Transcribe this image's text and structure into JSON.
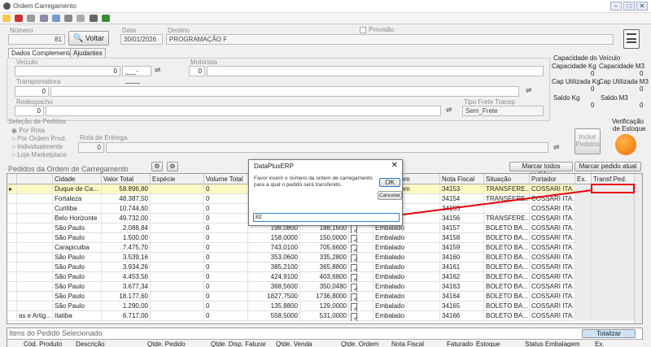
{
  "window": {
    "title": "Ordem Carregamento"
  },
  "header": {
    "numero_label": "Número",
    "numero_value": "81",
    "voltar_label": "Voltar",
    "data_label": "Data",
    "data_value": "30/01/2026",
    "destino_label": "Destino",
    "destino_value": "PROGRAMAÇÃO F",
    "previsao_label": "Previsão"
  },
  "tabs": [
    "Dados Complementares",
    "Ajudantes"
  ],
  "form": {
    "veiculo_label": "Veículo",
    "veiculo_value": "0",
    "placa_value": "___-____",
    "motorista_label": "Motorista",
    "motorista_value": "0",
    "transportadora_label": "Transportadora",
    "transportadora_value": "0",
    "redespacho_label": "Redespacho",
    "redespacho_value": "0",
    "tipo_frete_label": "Tipo Frete Transp",
    "tipo_frete_value": "Sem_Frete"
  },
  "capacidade": {
    "title": "Capacidade do Veículo",
    "cap_kg_label": "Capacidade Kg",
    "cap_kg_value": "0",
    "cap_m3_label": "Capacidade M3",
    "cap_m3_value": "0",
    "util_kg_label": "Cap Utilizada Kg",
    "util_kg_value": "0",
    "util_m3_label": "Cap Utilizada M3",
    "util_m3_value": "0",
    "saldo_kg_label": "Saldo Kg",
    "saldo_kg_value": "0",
    "saldo_m3_label": "Saldo M3",
    "saldo_m3_value": "0"
  },
  "selecao": {
    "title": "Seleção de Pedidos",
    "options": [
      "Por Rota",
      "Por Ordem Prod.",
      "Individualmente",
      "Loja Marketplace"
    ],
    "rota_label": "Rota de Entrega",
    "rota_value": "0",
    "incluir_label_1": "Incluir",
    "incluir_label_2": "Pedidos"
  },
  "estoque": {
    "label_1": "Verificação",
    "label_2": "de Estoque"
  },
  "pedidos": {
    "title": "Pedidos da Ordem de Carregamento",
    "marcar_todos": "Marcar todos pedidos",
    "marcar_atual": "Marcar pedido atual",
    "columns": [
      "Cidade",
      "Valor Total",
      "Espécie",
      "Volume Total",
      "",
      "",
      "",
      "Embalagem",
      "Nota Fiscal",
      "Situação",
      "Portador",
      "Ex.",
      "Transf.Ped."
    ],
    "rows": [
      {
        "pre": "",
        "cidade": "Duque de Ca...",
        "valor": "58.896,80",
        "volume": "0",
        "a": "",
        "b": "",
        "emb": "Embalagem",
        "nf": "34153",
        "sit": "TRANSFERE...",
        "port": "COSSARI ITA..."
      },
      {
        "pre": "",
        "cidade": "Fortaleza",
        "valor": "48.387,50",
        "volume": "0",
        "a": "",
        "b": "",
        "emb": "",
        "nf": "34154",
        "sit": "TRANSFERE...",
        "port": "COSSARI ITA..."
      },
      {
        "pre": "",
        "cidade": "Curitiba",
        "valor": "10.744,60",
        "volume": "0",
        "a": "",
        "b": "",
        "emb": "",
        "nf": "34155",
        "sit": "",
        "port": "COSSARI ITA..."
      },
      {
        "pre": "",
        "cidade": "Belo Horizonte",
        "valor": "49.732,00",
        "volume": "0",
        "a": "",
        "b": "",
        "emb": "",
        "nf": "34156",
        "sit": "TRANSFERE...",
        "port": "COSSARI ITA..."
      },
      {
        "pre": "",
        "cidade": "São Paulo",
        "valor": "2.088,84",
        "volume": "0",
        "a": "198,0800",
        "b": "188,1600",
        "emb": "Embalado",
        "nf": "34157",
        "sit": "BOLETO BA...",
        "port": "COSSARI ITA..."
      },
      {
        "pre": "",
        "cidade": "São Paulo",
        "valor": "1.500,00",
        "volume": "0",
        "a": "158,0000",
        "b": "150,0000",
        "emb": "Embalado",
        "nf": "34158",
        "sit": "BOLETO BA...",
        "port": "COSSARI ITA..."
      },
      {
        "pre": "",
        "cidade": "Carapicuiba",
        "valor": "7.475,70",
        "volume": "0",
        "a": "743,0100",
        "b": "705,6600",
        "emb": "Embalado",
        "nf": "34159",
        "sit": "BOLETO BA...",
        "port": "COSSARI ITA..."
      },
      {
        "pre": "",
        "cidade": "São Paulo",
        "valor": "3.539,16",
        "volume": "0",
        "a": "353,0600",
        "b": "335,2800",
        "emb": "Embalado",
        "nf": "34160",
        "sit": "BOLETO BA...",
        "port": "COSSARI ITA..."
      },
      {
        "pre": "",
        "cidade": "São Paulo",
        "valor": "3.934,26",
        "volume": "0",
        "a": "385,2100",
        "b": "365,8800",
        "emb": "Embalado",
        "nf": "34161",
        "sit": "BOLETO BA...",
        "port": "COSSARI ITA..."
      },
      {
        "pre": "",
        "cidade": "São Paulo",
        "valor": "4.453,56",
        "volume": "0",
        "a": "424,9100",
        "b": "403,6800",
        "emb": "Embalado",
        "nf": "34162",
        "sit": "BOLETO BA...",
        "port": "COSSARI ITA..."
      },
      {
        "pre": "",
        "cidade": "São Paulo",
        "valor": "3.677,34",
        "volume": "0",
        "a": "368,5600",
        "b": "350,0480",
        "emb": "Embalado",
        "nf": "34163",
        "sit": "BOLETO BA...",
        "port": "COSSARI ITA..."
      },
      {
        "pre": "",
        "cidade": "São Paulo",
        "valor": "18.177,60",
        "volume": "0",
        "a": "1827,7500",
        "b": "1736,8000",
        "emb": "Embalado",
        "nf": "34164",
        "sit": "BOLETO BA...",
        "port": "COSSARI ITA..."
      },
      {
        "pre": "",
        "cidade": "São Paulo",
        "valor": "1.290,00",
        "volume": "0",
        "a": "135,8800",
        "b": "129,0000",
        "emb": "Embalado",
        "nf": "34165",
        "sit": "BOLETO BA...",
        "port": "COSSARI ITA..."
      },
      {
        "pre": "as e Artig...",
        "cidade": "Itatiba",
        "valor": "6.717,00",
        "volume": "0",
        "a": "558,5000",
        "b": "531,0000",
        "emb": "Embalado",
        "nf": "34166",
        "sit": "BOLETO BA...",
        "port": "COSSARI ITA..."
      }
    ]
  },
  "dialog": {
    "title": "DataPlusERP",
    "message": "Favor inserir o número da ordem de carregamento para a qual o pedido será transferido.",
    "ok": "OK",
    "cancel": "Cancelar",
    "input_value": "82"
  },
  "itens": {
    "title": "Itens do Pedido Selecionado",
    "totalizar": "Totalizar",
    "columns": [
      "Cód. Produto",
      "Descrição",
      "Qtde. Pedido",
      "Qtde. Disp. Faturar",
      "Qtde. Venda",
      "Qtde. Ordem",
      "Nota Fiscal",
      "Faturado",
      "Estoque",
      "Status Embalagem",
      "Ex."
    ]
  },
  "colors": {
    "highlight": "#e8000a",
    "selected_row": "#fff9c4"
  }
}
